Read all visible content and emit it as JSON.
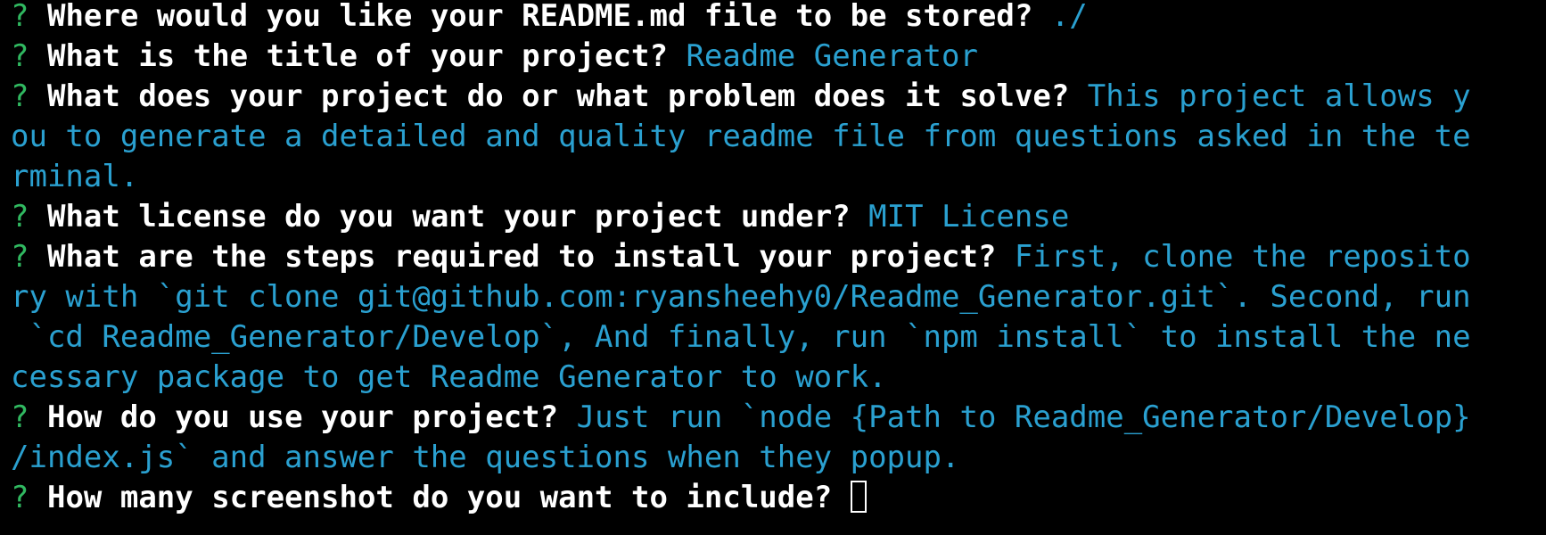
{
  "colors": {
    "background": "#000000",
    "prompt_mark": "#30b860",
    "question": "#ffffff",
    "answer": "#2aa0d0"
  },
  "prompt_symbol": "?",
  "lines": [
    {
      "question": "Where would you like your README.md file to be stored?",
      "answer": "./"
    },
    {
      "question": "What is the title of your project?",
      "answer": "Readme Generator"
    },
    {
      "question": "What does your project do or what problem does it solve?",
      "answer": "This project allows y"
    },
    {
      "answer": "ou to generate a detailed and quality readme file from questions asked in the te"
    },
    {
      "answer": "rminal."
    },
    {
      "question": "What license do you want your project under?",
      "answer": "MIT License"
    },
    {
      "question": "What are the steps required to install your project?",
      "answer": "First, clone the reposito"
    },
    {
      "answer": "ry with `git clone git@github.com:ryansheehy0/Readme_Generator.git`. Second, run"
    },
    {
      "answer": " `cd Readme_Generator/Develop`, And finally, run `npm install` to install the ne"
    },
    {
      "answer": "cessary package to get Readme Generator to work."
    },
    {
      "question": "How do you use your project?",
      "answer": "Just run `node {Path to Readme_Generator/Develop}"
    },
    {
      "answer": "/index.js` and answer the questions when they popup."
    },
    {
      "question": "How many screenshot do you want to include?",
      "answer": ""
    }
  ]
}
